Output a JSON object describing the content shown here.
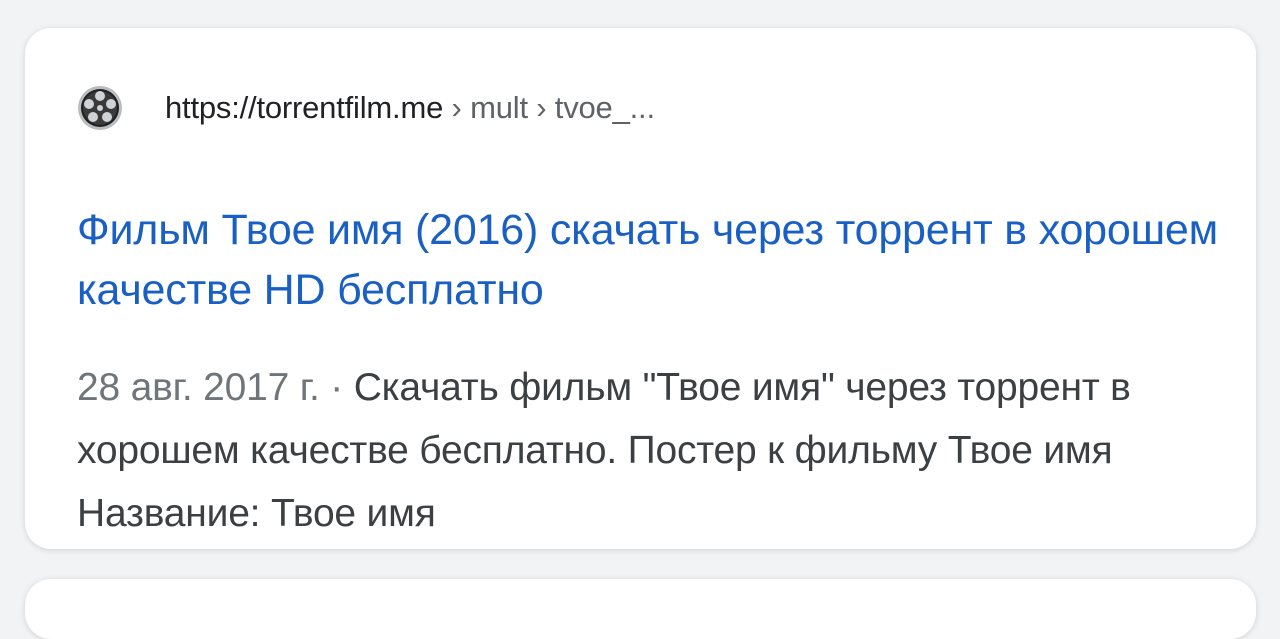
{
  "result": {
    "url_host": "https://torrentfilm.me",
    "url_path": " › mult › tvoe_...",
    "favicon": "film-reel-icon",
    "title": "Фильм Твое имя (2016) скачать через торрент в хорошем качестве HD бесплатно",
    "date": "28 авг. 2017 г.",
    "separator": " · ",
    "snippet": "Скачать фильм \"Твое имя\" через торрент в хорошем качестве бесплатно. Постер к фильму Твое имя Название: Твое имя"
  },
  "colors": {
    "link": "#1a5fc4",
    "text": "#3c4043",
    "date": "#70757a",
    "background": "#f1f3f4",
    "card": "#ffffff"
  }
}
